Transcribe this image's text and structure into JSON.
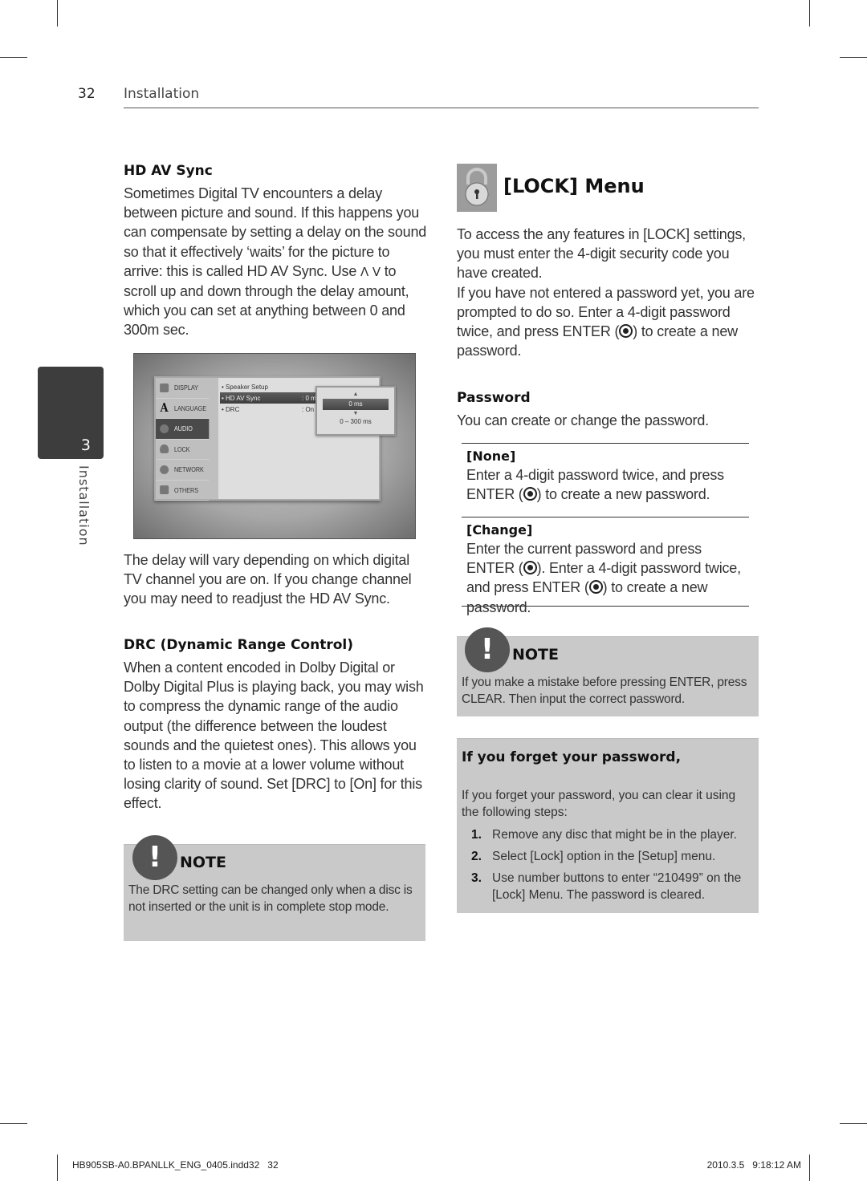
{
  "header": {
    "page_number": "32",
    "section": "Installation"
  },
  "side_tab": {
    "chapter_number": "3",
    "chapter_label": "Installation"
  },
  "hd_av_sync": {
    "title": "HD AV Sync",
    "paragraph_1_a": "Sometimes Digital TV encounters a delay between picture and sound. If this happens you can compensate by setting a delay on the sound so that it effectively ‘waits’ for the picture to arrive: this is called HD AV Sync. Use ",
    "up_glyph": "Λ",
    "down_glyph": "V",
    "paragraph_1_b": " to scroll up and down through the delay amount, which you can set at anything between 0 and 300m sec.",
    "paragraph_2": "The delay will vary depending on which digital TV channel you are on. If you change channel you may need to readjust the HD AV Sync."
  },
  "setup_screen": {
    "sidebar": [
      {
        "label": "DISPLAY",
        "icon": "display-icon",
        "active": false
      },
      {
        "label": "LANGUAGE",
        "icon": "language-icon",
        "active": false
      },
      {
        "label": "AUDIO",
        "icon": "audio-icon",
        "active": true
      },
      {
        "label": "LOCK",
        "icon": "lock-icon",
        "active": false
      },
      {
        "label": "NETWORK",
        "icon": "network-icon",
        "active": false
      },
      {
        "label": "OTHERS",
        "icon": "others-icon",
        "active": false
      }
    ],
    "rows": [
      {
        "label": "• Speaker Setup",
        "value": ""
      },
      {
        "label": "• HD AV Sync",
        "value": ": 0 ms"
      },
      {
        "label": "• DRC",
        "value": ": On"
      }
    ],
    "popup": {
      "up": "▲",
      "value": "0 ms",
      "down": "▼",
      "range": "0 – 300 ms"
    }
  },
  "drc": {
    "title": "DRC (Dynamic Range Control)",
    "paragraph": "When a content encoded in Dolby Digital or Dolby Digital Plus is playing back, you may wish to compress the dynamic range of the audio output (the difference between the loudest sounds and the quietest ones). This allows you to listen to a movie at a lower volume without losing clarity of sound. Set [DRC] to [On] for this effect."
  },
  "note_left": {
    "badge": "!",
    "title": "NOTE",
    "text": "The DRC setting can be changed only when a disc is not inserted or the unit is in complete stop mode."
  },
  "lock_menu": {
    "title": "[LOCK] Menu",
    "paragraph_1": "To access the any features in [LOCK] settings, you must enter the 4-digit security code you have created.",
    "paragraph_2_a": "If you have not entered a password yet, you are prompted to do so. Enter a 4-digit password twice, and press ENTER (",
    "paragraph_2_b": ") to create a new password."
  },
  "password": {
    "title": "Password",
    "intro": "You can create or change the password.",
    "options": [
      {
        "title": "[None]",
        "text_a": "Enter a 4-digit password twice, and press ENTER (",
        "text_b": ") to create a new password."
      },
      {
        "title": "[Change]",
        "text_a": "Enter the current password and press ENTER (",
        "text_b": "). Enter a 4-digit password twice, and press ENTER (",
        "text_c": ") to create a new password."
      }
    ]
  },
  "note_right": {
    "badge": "!",
    "title": "NOTE",
    "text": "If you make a mistake before pressing ENTER, press CLEAR. Then input the correct password."
  },
  "forget": {
    "title": "If you forget your password,",
    "intro": "If you forget your password, you can clear it using the following steps:",
    "steps": [
      {
        "num": "1.",
        "text": "Remove any disc that might be in the player."
      },
      {
        "num": "2.",
        "text": "Select [Lock] option in the [Setup] menu."
      },
      {
        "num": "3.",
        "text": "Use number buttons to enter “210499” on the [Lock] Menu. The password is cleared."
      }
    ]
  },
  "footer": {
    "file": "HB905SB-A0.BPANLLK_ENG_0405.indd32   32",
    "timestamp": "2010.3.5   9:18:12 AM"
  }
}
